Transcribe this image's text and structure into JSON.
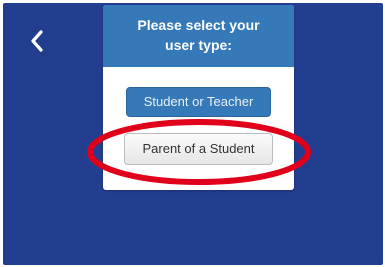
{
  "header": {
    "back_icon": "chevron-left-icon"
  },
  "dialog": {
    "title": "Please select your user type:",
    "options": [
      {
        "label": "Student or Teacher"
      },
      {
        "label": "Parent of a Student"
      }
    ]
  },
  "annotation": {
    "shape": "ellipse",
    "color": "#e0001b"
  },
  "colors": {
    "background": "#233d8f",
    "header": "#3579b8",
    "primary_button": "#3579b8",
    "secondary_button": "#efefef"
  }
}
